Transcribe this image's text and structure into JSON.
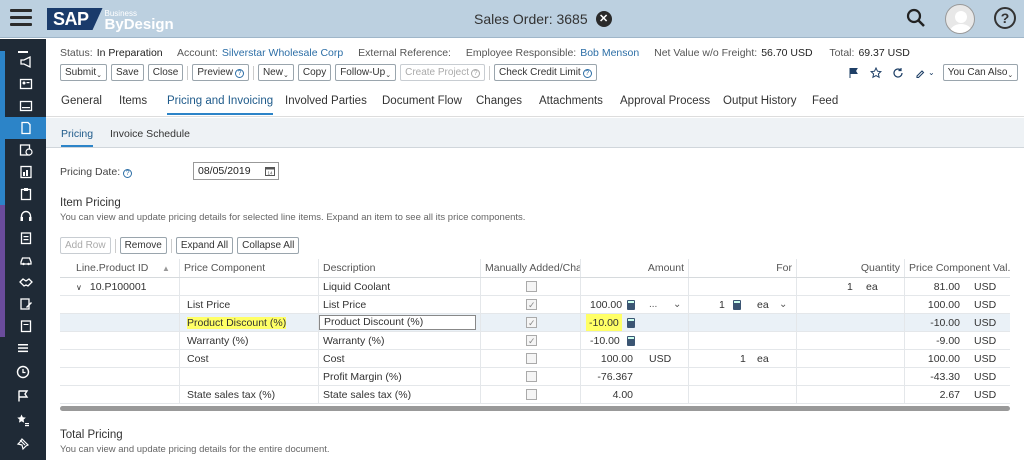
{
  "header": {
    "logo_sap": "SAP",
    "logo_business": "Business",
    "logo_bydesign": "ByDesign",
    "title": "Sales Order: 3685"
  },
  "status_bar": {
    "status_label": "Status:",
    "status_value": "In Preparation",
    "account_label": "Account:",
    "account_value": "Silverstar Wholesale Corp",
    "extref_label": "External Reference:",
    "employee_label": "Employee Responsible:",
    "employee_value": "Bob Menson",
    "net_label": "Net Value w/o Freight:",
    "net_value": "56.70 USD",
    "total_label": "Total:",
    "total_value": "69.37 USD"
  },
  "toolbar": {
    "submit": "Submit",
    "save": "Save",
    "close": "Close",
    "preview": "Preview",
    "new": "New",
    "copy": "Copy",
    "follow_up": "Follow-Up",
    "create_project": "Create Project",
    "check_credit": "Check Credit Limit",
    "you_can_also": "You Can Also"
  },
  "tabs": [
    "General",
    "Items",
    "Pricing and Invoicing",
    "Involved Parties",
    "Document Flow",
    "Changes",
    "Attachments",
    "Approval Process",
    "Output History",
    "Feed"
  ],
  "subtabs": [
    "Pricing",
    "Invoice Schedule"
  ],
  "pricing_date": {
    "label": "Pricing Date:",
    "value": "08/05/2019"
  },
  "item_pricing": {
    "title": "Item Pricing",
    "desc": "You can view and update pricing details for selected line items. Expand an item to see all its price components.",
    "buttons": {
      "add_row": "Add Row",
      "remove": "Remove",
      "expand_all": "Expand All",
      "collapse_all": "Collapse All"
    },
    "columns": {
      "line": "Line.Product ID",
      "component": "Price Component",
      "description": "Description",
      "manual": "Manually Added/Cha...",
      "amount": "Amount",
      "for": "For",
      "quantity": "Quantity",
      "pcv": "Price Component Val..."
    },
    "item": {
      "line": "10.P100001",
      "description": "Liquid Coolant",
      "quantity": "1",
      "unit": "ea",
      "pcv": "81.00",
      "currency": "USD"
    },
    "rows": [
      {
        "component": "List Price",
        "description": "List Price",
        "amount": "100.00",
        "dots": "...",
        "for_qty": "1",
        "for_unit": "ea",
        "pcv": "100.00",
        "currency": "USD"
      },
      {
        "component": "Product Discount (%)",
        "description": "Product Discount (%)",
        "amount": "-10.00",
        "pcv": "-10.00",
        "currency": "USD"
      },
      {
        "component": "Warranty (%)",
        "description": "Warranty (%)",
        "amount": "-10.00",
        "pcv": "-9.00",
        "currency": "USD"
      },
      {
        "component": "Cost",
        "description": "Cost",
        "amount": "100.00",
        "amount_cur": "USD",
        "for_qty": "1",
        "for_unit": "ea",
        "pcv": "100.00",
        "currency": "USD"
      },
      {
        "component": "",
        "description": "Profit Margin (%)",
        "amount": "-76.367",
        "pcv": "-43.30",
        "currency": "USD"
      },
      {
        "component": "State sales tax (%)",
        "description": "State sales tax (%)",
        "amount": "4.00",
        "pcv": "2.67",
        "currency": "USD"
      }
    ]
  },
  "total_pricing": {
    "title": "Total Pricing",
    "desc": "You can view and update pricing details for the entire document."
  }
}
